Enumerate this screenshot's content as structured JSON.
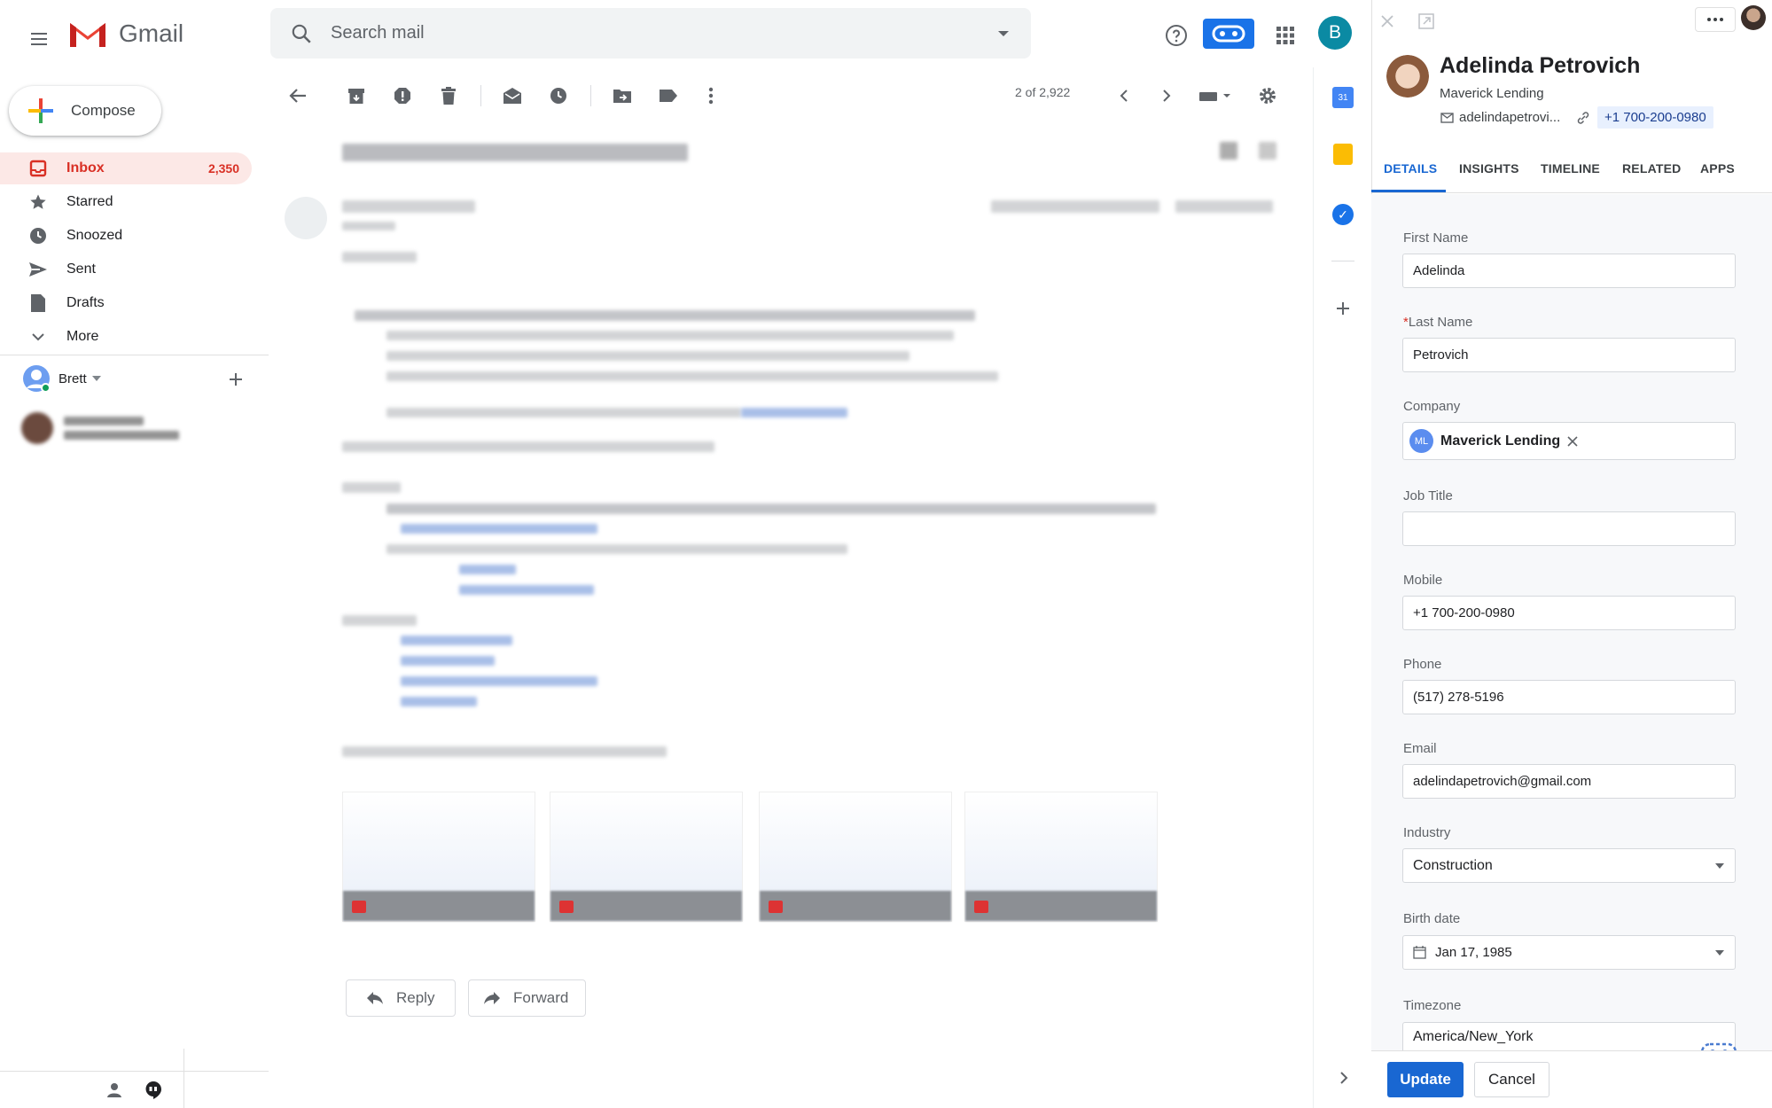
{
  "app": {
    "name": "Gmail"
  },
  "search": {
    "placeholder": "Search mail"
  },
  "header": {
    "avatar_letter": "B",
    "icons": [
      "menu-icon",
      "gmail-logo",
      "search-icon",
      "dropdown-icon",
      "help-icon",
      "extension-icon",
      "apps-grid-icon"
    ]
  },
  "compose": {
    "label": "Compose"
  },
  "nav": [
    {
      "label": "Inbox",
      "count": "2,350",
      "icon": "inbox-icon"
    },
    {
      "label": "Starred",
      "icon": "star-icon"
    },
    {
      "label": "Snoozed",
      "icon": "clock-icon"
    },
    {
      "label": "Sent",
      "icon": "send-icon"
    },
    {
      "label": "Drafts",
      "icon": "draft-icon"
    },
    {
      "label": "More",
      "icon": "chevron-down-icon"
    }
  ],
  "hangouts": {
    "user": "Brett"
  },
  "toolbar": {
    "pager": "2 of 2,922"
  },
  "email": {
    "reply_label": "Reply",
    "forward_label": "Forward"
  },
  "crm": {
    "name": "Adelinda Petrovich",
    "company": "Maverick Lending",
    "email_short": "adelindapetrovi...",
    "phone": "+1 700-200-0980",
    "tabs": [
      "DETAILS",
      "INSIGHTS",
      "TIMELINE",
      "RELATED",
      "APPS"
    ],
    "fields": {
      "first_name": {
        "label": "First Name",
        "value": "Adelinda"
      },
      "last_name": {
        "label": "*Last Name",
        "required_mark": "*",
        "label_text": "Last Name",
        "value": "Petrovich"
      },
      "company": {
        "label": "Company",
        "value": "Maverick Lending",
        "initials": "ML"
      },
      "job_title": {
        "label": "Job Title",
        "value": ""
      },
      "mobile": {
        "label": "Mobile",
        "value": "+1 700-200-0980"
      },
      "phone": {
        "label": "Phone",
        "value": "(517) 278-5196"
      },
      "email": {
        "label": "Email",
        "value": "adelindapetrovich@gmail.com"
      },
      "industry": {
        "label": "Industry",
        "value": "Construction"
      },
      "birth_date": {
        "label": "Birth date",
        "value": "Jan 17, 1985"
      },
      "timezone": {
        "label": "Timezone",
        "value": "America/New_York"
      }
    },
    "update_label": "Update",
    "cancel_label": "Cancel"
  },
  "colors": {
    "gmail_red": "#d93025",
    "accent_blue": "#1967d2",
    "inbox_bg": "#fce8e6"
  }
}
